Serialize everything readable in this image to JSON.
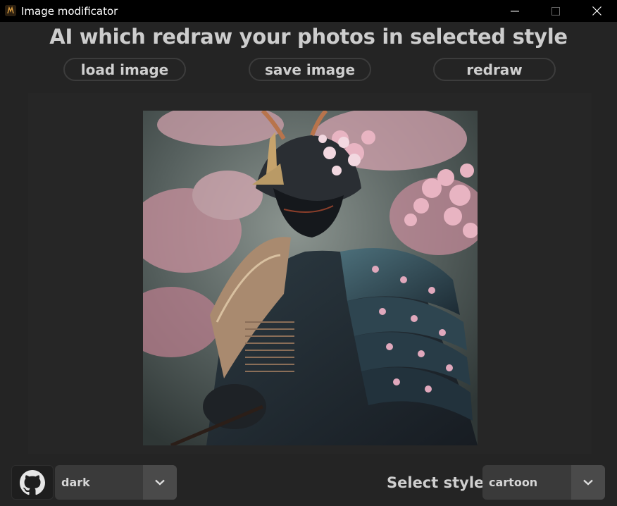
{
  "window": {
    "title": "Image modificator",
    "icon": "app-icon",
    "controls": [
      "minimize-icon",
      "maximize-icon",
      "close-icon"
    ]
  },
  "header": {
    "headline": "AI which redraw your photos in selected style"
  },
  "toolbar": {
    "load_label": "load image",
    "save_label": "save image",
    "redraw_label": "redraw"
  },
  "preview": {
    "image_icon": "samurai-cherry-blossom-image"
  },
  "footer": {
    "github_icon": "github-icon",
    "theme_value": "dark",
    "style_label": "Select style:",
    "style_value": "cartoon"
  },
  "colors": {
    "background": "#242424",
    "titlebar": "#000000",
    "button_border": "#3c3c3c",
    "dropdown": "#3a3a3a",
    "text": "#cdcdcd"
  }
}
